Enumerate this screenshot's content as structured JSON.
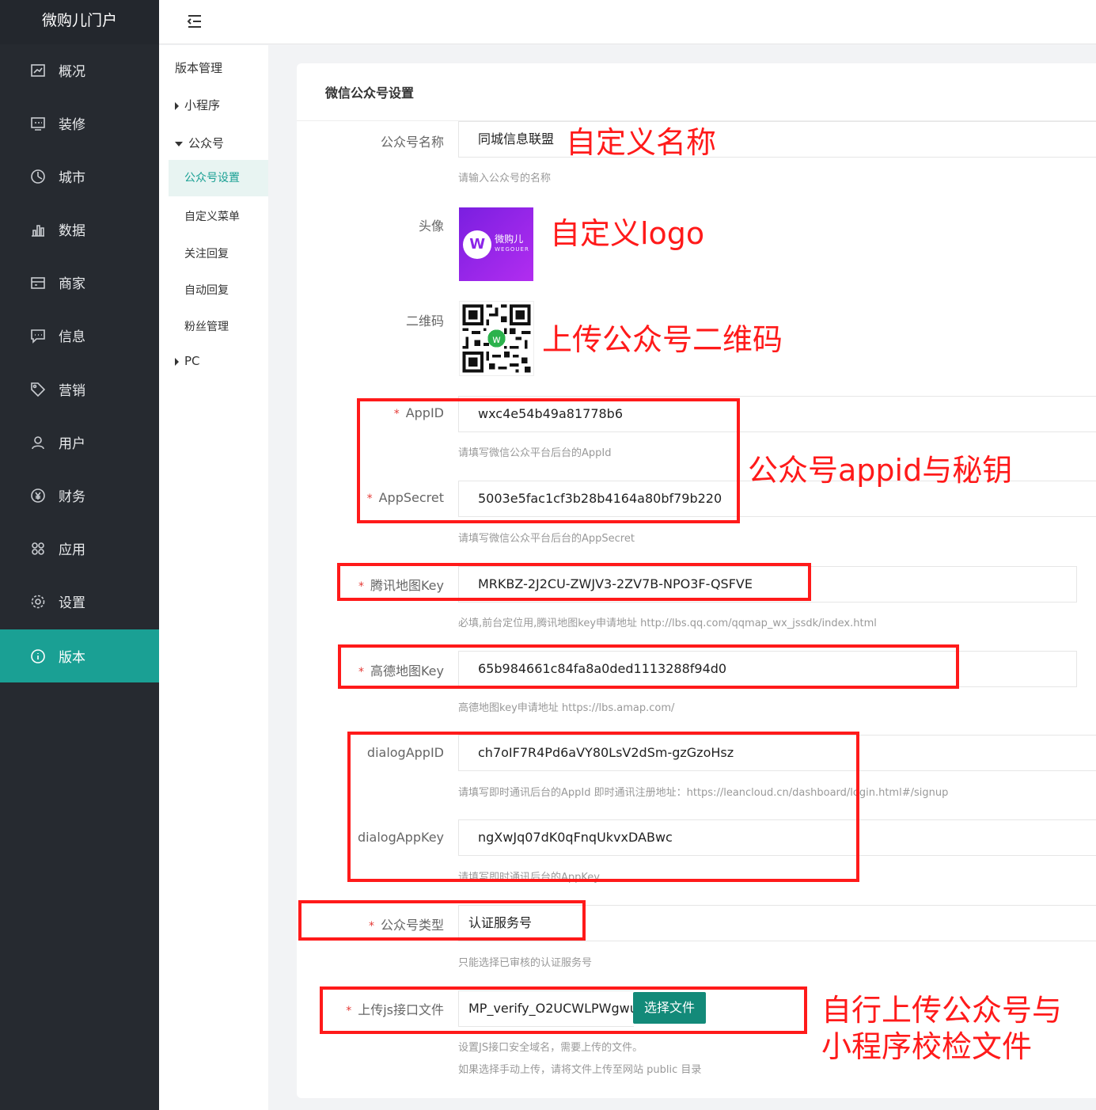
{
  "brand": "微购儿门户",
  "nav": [
    {
      "label": "概况",
      "icon": "dashboard-icon"
    },
    {
      "label": "装修",
      "icon": "decoration-icon"
    },
    {
      "label": "城市",
      "icon": "city-icon"
    },
    {
      "label": "数据",
      "icon": "chart-icon"
    },
    {
      "label": "商家",
      "icon": "store-icon"
    },
    {
      "label": "信息",
      "icon": "message-icon"
    },
    {
      "label": "营销",
      "icon": "tag-icon"
    },
    {
      "label": "用户",
      "icon": "user-icon"
    },
    {
      "label": "财务",
      "icon": "yen-icon"
    },
    {
      "label": "应用",
      "icon": "apps-icon"
    },
    {
      "label": "设置",
      "icon": "gear-icon"
    },
    {
      "label": "版本",
      "icon": "info-icon",
      "active": true
    }
  ],
  "subnav": {
    "header": "版本管理",
    "miniprogram": "小程序",
    "official": "公众号",
    "items": [
      "公众号设置",
      "自定义菜单",
      "关注回复",
      "自动回复",
      "粉丝管理"
    ],
    "pc": "PC"
  },
  "form": {
    "title": "微信公众号设置",
    "name_label": "公众号名称",
    "name_value": "同城信息联盟",
    "name_hint": "请输入公众号的名称",
    "avatar_label": "头像",
    "avatar_brand": "微购儿",
    "avatar_sub": "WEGOUER",
    "qr_label": "二维码",
    "appid_label": "AppID",
    "appid_value": "wxc4e54b49a81778b6",
    "appid_hint": "请填写微信公众平台后台的AppId",
    "secret_label": "AppSecret",
    "secret_value": "5003e5fac1cf3b28b4164a80bf79b220",
    "secret_hint": "请填写微信公众平台后台的AppSecret",
    "tencent_label": "腾讯地图Key",
    "tencent_value": "MRKBZ-2J2CU-ZWJV3-2ZV7B-NPO3F-QSFVE",
    "tencent_hint": "必填,前台定位用,腾讯地图key申请地址 http://lbs.qq.com/qqmap_wx_jssdk/index.html",
    "amap_label": "高德地图Key",
    "amap_value": "65b984661c84fa8a0ded1113288f94d0",
    "amap_hint": "高德地图key申请地址 https://lbs.amap.com/",
    "dialog_id_label": "dialogAppID",
    "dialog_id_value": "ch7oIF7R4Pd6aVY80LsV2dSm-gzGzoHsz",
    "dialog_id_hint": "请填写即时通讯后台的AppId 即时通讯注册地址：https://leancloud.cn/dashboard/login.html#/signup",
    "dialog_key_label": "dialogAppKey",
    "dialog_key_value": "ngXwJq07dK0qFnqUkvxDABwc",
    "dialog_key_hint": "请填写即时通讯后台的AppKey",
    "type_label": "公众号类型",
    "type_value": "认证服务号",
    "type_hint": "只能选择已审核的认证服务号",
    "js_label": "上传js接口文件",
    "js_value": "MP_verify_O2UCWLPWgwu",
    "js_button": "选择文件",
    "js_hint1": "设置JS接口安全域名，需要上传的文件。",
    "js_hint2": "如果选择手动上传，请将文件上传至网站 public 目录"
  },
  "annotations": {
    "name": "自定义名称",
    "logo": "自定义logo",
    "qr": "上传公众号二维码",
    "appid": "公众号appid与秘钥",
    "upload1": "自行上传公众号与",
    "upload2": "小程序校检文件"
  },
  "colors": {
    "sidebar": "#262a30",
    "accent": "#1aa094",
    "annotation": "#ff1a1a"
  }
}
